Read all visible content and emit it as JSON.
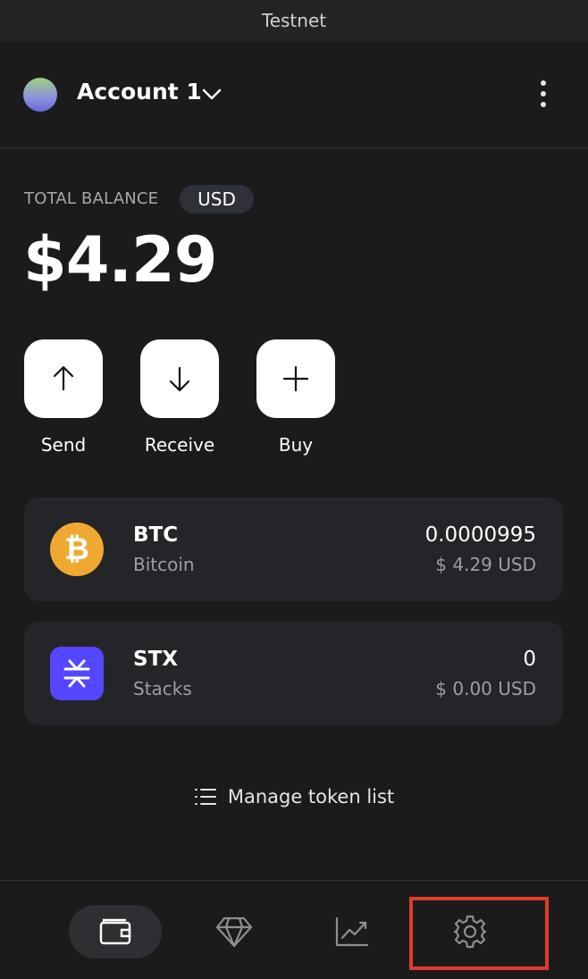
{
  "network": {
    "label": "Testnet"
  },
  "account": {
    "name": "Account 1"
  },
  "balance": {
    "label": "TOTAL BALANCE",
    "currency": "USD",
    "value": "$4.29"
  },
  "actions": [
    {
      "label": "Send",
      "icon": "arrow-up-icon"
    },
    {
      "label": "Receive",
      "icon": "arrow-down-icon"
    },
    {
      "label": "Buy",
      "icon": "plus-icon"
    }
  ],
  "tokens": [
    {
      "symbol": "BTC",
      "name": "Bitcoin",
      "amount": "0.0000995",
      "usd": "$ 4.29 USD",
      "icon": "bitcoin-icon",
      "icon_glyph": "₿",
      "color": "#f0a930"
    },
    {
      "symbol": "STX",
      "name": "Stacks",
      "amount": "0",
      "usd": "$ 0.00 USD",
      "icon": "stacks-icon",
      "color": "#5546ff"
    }
  ],
  "manage_tokens": {
    "label": "Manage token list"
  },
  "nav": [
    {
      "name": "wallet",
      "icon": "wallet-icon",
      "active": true
    },
    {
      "name": "collectibles",
      "icon": "diamond-icon",
      "active": false
    },
    {
      "name": "activity",
      "icon": "chart-icon",
      "active": false
    },
    {
      "name": "settings",
      "icon": "gear-icon",
      "active": false
    }
  ],
  "colors": {
    "background": "#1b1b1c",
    "card": "#242529",
    "highlight": "#e23b2b"
  }
}
